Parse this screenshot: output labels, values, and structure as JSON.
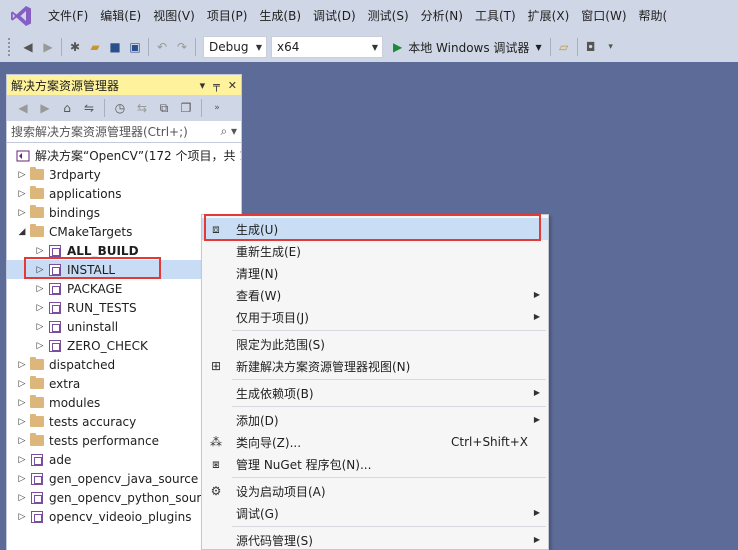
{
  "menubar": {
    "items": [
      "文件(F)",
      "编辑(E)",
      "视图(V)",
      "项目(P)",
      "生成(B)",
      "调试(D)",
      "测试(S)",
      "分析(N)",
      "工具(T)",
      "扩展(X)",
      "窗口(W)",
      "帮助("
    ]
  },
  "toolbar": {
    "configuration": "Debug",
    "platform": "x64",
    "run_label": "本地 Windows 调试器"
  },
  "solution_explorer": {
    "title": "解决方案资源管理器",
    "search_placeholder": "搜索解决方案资源管理器(Ctrl+;)",
    "solution_label": "解决方案“OpenCV”(172 个项目，共 1",
    "folders_top": [
      "3rdparty",
      "applications",
      "bindings"
    ],
    "cmake_folder": "CMakeTargets",
    "cmake_children": [
      "ALL_BUILD",
      "INSTALL",
      "PACKAGE",
      "RUN_TESTS",
      "uninstall",
      "ZERO_CHECK"
    ],
    "folders_bottom": [
      "dispatched",
      "extra",
      "modules",
      "tests accuracy",
      "tests performance"
    ],
    "projects_bottom": [
      "ade",
      "gen_opencv_java_source",
      "gen_opencv_python_sour",
      "opencv_videoio_plugins"
    ]
  },
  "context_menu": {
    "items": [
      {
        "label": "生成(U)",
        "icon": "build-icon",
        "highlight": true
      },
      {
        "label": "重新生成(E)"
      },
      {
        "label": "清理(N)"
      },
      {
        "label": "查看(W)",
        "submenu": true
      },
      {
        "label": "仅用于项目(J)",
        "submenu": true
      },
      {
        "separator": true
      },
      {
        "label": "限定为此范围(S)"
      },
      {
        "label": "新建解决方案资源管理器视图(N)",
        "icon": "new-view-icon"
      },
      {
        "separator": true
      },
      {
        "label": "生成依赖项(B)",
        "submenu": true
      },
      {
        "separator": true
      },
      {
        "label": "添加(D)",
        "submenu": true
      },
      {
        "label": "类向导(Z)...",
        "icon": "class-wizard-icon",
        "shortcut": "Ctrl+Shift+X"
      },
      {
        "label": "管理 NuGet 程序包(N)...",
        "icon": "nuget-icon"
      },
      {
        "separator": true
      },
      {
        "label": "设为启动项目(A)",
        "icon": "gear-icon"
      },
      {
        "label": "调试(G)",
        "submenu": true
      },
      {
        "separator": true
      },
      {
        "label": "源代码管理(S)",
        "submenu": true
      }
    ]
  },
  "colors": {
    "accent_highlight": "#c9def5",
    "annotation_red": "#e53935",
    "workspace_bg": "#5d6b99",
    "title_yellow": "#fff29d"
  }
}
